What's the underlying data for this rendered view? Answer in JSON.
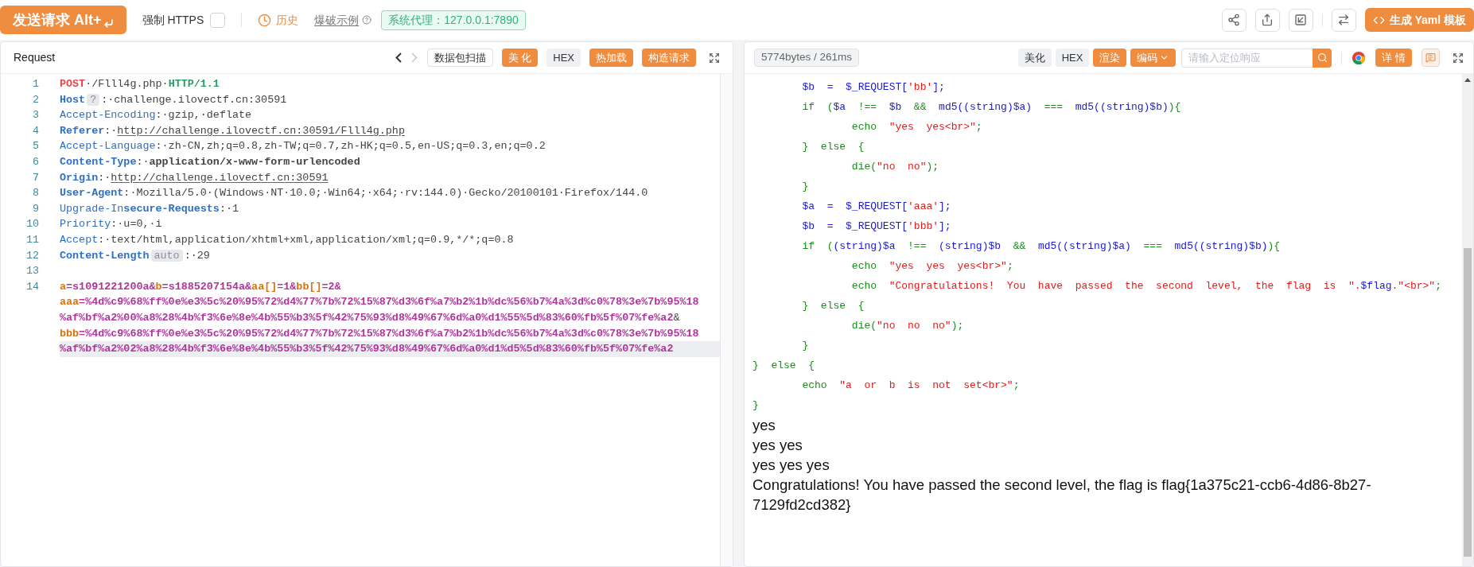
{
  "top_bar": {
    "send_button": "发送请求 Alt+",
    "force_https": {
      "label": "强制 HTTPS",
      "checked": false
    },
    "history": "历史",
    "examples": "爆破示例",
    "proxy": "系统代理：127.0.0.1:7890",
    "yaml_button": "生成 Yaml 模板"
  },
  "request": {
    "title": "Request",
    "back_disabled": false,
    "forward_disabled": true,
    "buttons": [
      {
        "label": "数据包扫描",
        "kind": "outline"
      },
      {
        "label": "美 化",
        "kind": "primary"
      },
      {
        "label": "HEX",
        "kind": "plain"
      },
      {
        "label": "热加载",
        "kind": "primary"
      },
      {
        "label": "构造请求",
        "kind": "primary"
      }
    ],
    "lines": [
      {
        "number": "1",
        "rows": [
          {
            "cursor": false,
            "segments": [
              {
                "kind": "method",
                "text": "POST"
              },
              {
                "kind": "text",
                "text": "·/Flll4g.php·"
              },
              {
                "kind": "protocol",
                "text": "HTTP/1.1"
              }
            ]
          }
        ]
      },
      {
        "number": "2",
        "rows": [
          {
            "cursor": false,
            "segments": [
              {
                "kind": "key_bold",
                "text": "Host"
              },
              {
                "kind": "badge",
                "text": "?"
              },
              {
                "kind": "text",
                "text": ":·challenge.ilovectf.cn:30591"
              }
            ]
          }
        ]
      },
      {
        "number": "3",
        "rows": [
          {
            "cursor": false,
            "segments": [
              {
                "kind": "key",
                "text": "Accept-Encoding"
              },
              {
                "kind": "text",
                "text": ":·gzip,·deflate"
              }
            ]
          }
        ]
      },
      {
        "number": "4",
        "rows": [
          {
            "cursor": false,
            "segments": [
              {
                "kind": "key_bold",
                "text": "Referer"
              },
              {
                "kind": "text",
                "text": ":·"
              },
              {
                "kind": "url",
                "text": "http://challenge.ilovectf.cn:30591/Flll4g.php"
              }
            ]
          }
        ]
      },
      {
        "number": "5",
        "rows": [
          {
            "cursor": false,
            "segments": [
              {
                "kind": "key",
                "text": "Accept-Language"
              },
              {
                "kind": "text",
                "text": ":·zh-CN,zh;q=0.8,zh-TW;q=0.7,zh-HK;q=0.5,en-US;q=0.3,en;q=0.2"
              }
            ]
          }
        ]
      },
      {
        "number": "6",
        "rows": [
          {
            "cursor": false,
            "segments": [
              {
                "kind": "key_bold",
                "text": "Content-Type"
              },
              {
                "kind": "text",
                "text": ":·"
              },
              {
                "kind": "text_bold",
                "text": "application/x-www-form-urlencoded"
              }
            ]
          }
        ]
      },
      {
        "number": "7",
        "rows": [
          {
            "cursor": false,
            "segments": [
              {
                "kind": "key_bold",
                "text": "Origin"
              },
              {
                "kind": "text",
                "text": ":·"
              },
              {
                "kind": "url",
                "text": "http://challenge.ilovectf.cn:30591"
              }
            ]
          }
        ]
      },
      {
        "number": "8",
        "rows": [
          {
            "cursor": false,
            "segments": [
              {
                "kind": "key_bold",
                "text": "User-Agent"
              },
              {
                "kind": "text",
                "text": ":·Mozilla/5.0·(Windows·NT·10.0;·Win64;·x64;·rv:144.0)·Gecko/20100101·Firefox/144.0"
              }
            ]
          }
        ]
      },
      {
        "number": "9",
        "rows": [
          {
            "cursor": false,
            "segments": [
              {
                "kind": "key",
                "text": "Upgrade-In"
              },
              {
                "kind": "key_bold",
                "text": "secure-Requests"
              },
              {
                "kind": "text",
                "text": ":·1"
              }
            ]
          }
        ]
      },
      {
        "number": "10",
        "rows": [
          {
            "cursor": false,
            "segments": [
              {
                "kind": "key",
                "text": "Priority"
              },
              {
                "kind": "text",
                "text": ":·u=0,·i"
              }
            ]
          }
        ]
      },
      {
        "number": "11",
        "rows": [
          {
            "cursor": false,
            "segments": [
              {
                "kind": "key",
                "text": "Accept"
              },
              {
                "kind": "text",
                "text": ":·text/html,application/xhtml+xml,application/xml;q=0.9,*/*;q=0.8"
              }
            ]
          }
        ]
      },
      {
        "number": "12",
        "rows": [
          {
            "cursor": false,
            "segments": [
              {
                "kind": "key_bold",
                "text": "Content-Length"
              },
              {
                "kind": "badge",
                "text": "auto"
              },
              {
                "kind": "text",
                "text": ":·29"
              }
            ]
          }
        ]
      },
      {
        "number": "13",
        "rows": [
          {
            "cursor": false,
            "segments": []
          }
        ]
      },
      {
        "number": "14",
        "rows": [
          {
            "cursor": false,
            "segments": [
              {
                "kind": "param_key",
                "text": "a"
              },
              {
                "kind": "param_value",
                "text": "=s1091221200a&"
              },
              {
                "kind": "param_key",
                "text": "b"
              },
              {
                "kind": "param_value",
                "text": "=s1885207154a&"
              },
              {
                "kind": "param_key",
                "text": "aa[]"
              },
              {
                "kind": "param_value",
                "text": "=1&"
              },
              {
                "kind": "param_key",
                "text": "bb[]"
              },
              {
                "kind": "param_value",
                "text": "=2&"
              }
            ]
          },
          {
            "cursor": false,
            "segments": [
              {
                "kind": "param_key",
                "text": "aaa"
              },
              {
                "kind": "param_value",
                "text": "=%4d%c9%68%ff%0e%e3%5c%20%95%72%d4%77%7b%72%15%87%d3%6f%a7%b2%1b%dc%56%b7%4a%3d%c0%78%3e%7b%95%18"
              }
            ]
          },
          {
            "cursor": false,
            "segments": [
              {
                "kind": "param_value",
                "text": "%af%bf%a2%00%a8%28%4b%f3%6e%8e%4b%55%b3%5f%42%75%93%d8%49%67%6d%a0%d1%55%5d%83%60%fb%5f%07%fe%a2"
              },
              {
                "kind": "text",
                "text": "&"
              }
            ]
          },
          {
            "cursor": false,
            "segments": [
              {
                "kind": "param_key",
                "text": "bbb"
              },
              {
                "kind": "param_value",
                "text": "=%4d%c9%68%ff%0e%e3%5c%20%95%72%d4%77%7b%72%15%87%d3%6f%a7%b2%1b%dc%56%b7%4a%3d%c0%78%3e%7b%95%18"
              }
            ]
          },
          {
            "cursor": true,
            "segments": [
              {
                "kind": "param_value",
                "text": "%af%bf%a2%02%a8%28%4b%f3%6e%8e%4b%55%b3%5f%42%75%93%d8%49%67%6d%a0%d1%d5%5d%83%60%fb%5f%07%fe%a2"
              }
            ]
          }
        ]
      }
    ]
  },
  "response": {
    "stats": "5774bytes / 261ms",
    "buttons": [
      {
        "label": "美化",
        "kind": "plain"
      },
      {
        "label": "HEX",
        "kind": "plain"
      },
      {
        "label": "渲染",
        "kind": "primary"
      }
    ],
    "encoding": "编码",
    "search": {
      "placeholder": "请输入定位响应"
    },
    "details": "详 情",
    "code": [
      [
        {
          "kind": "var",
          "text": "        $b  =  $_REQUEST["
        },
        {
          "kind": "str",
          "text": "'bb'"
        },
        {
          "kind": "var",
          "text": "];"
        }
      ],
      [
        {
          "kind": "kw",
          "text": "        if  ("
        },
        {
          "kind": "var",
          "text": "$a"
        },
        {
          "kind": "kw",
          "text": "  !==  "
        },
        {
          "kind": "var",
          "text": "$b"
        },
        {
          "kind": "kw",
          "text": "  &&  "
        },
        {
          "kind": "var",
          "text": "md5((string)$a)"
        },
        {
          "kind": "kw",
          "text": "  ===  "
        },
        {
          "kind": "var",
          "text": "md5((string)$b)"
        },
        {
          "kind": "kw",
          "text": "){"
        }
      ],
      [
        {
          "kind": "kw",
          "text": "                echo  "
        },
        {
          "kind": "str",
          "text": "\"yes  yes<br>\""
        },
        {
          "kind": "kw",
          "text": ";"
        }
      ],
      [
        {
          "kind": "kw",
          "text": "        }  else  {"
        }
      ],
      [
        {
          "kind": "kw",
          "text": "                die("
        },
        {
          "kind": "str",
          "text": "\"no  no\""
        },
        {
          "kind": "kw",
          "text": ");"
        }
      ],
      [
        {
          "kind": "kw",
          "text": "        }"
        }
      ],
      [
        {
          "kind": "var",
          "text": "        $a  =  $_REQUEST["
        },
        {
          "kind": "str",
          "text": "'aaa'"
        },
        {
          "kind": "var",
          "text": "];"
        }
      ],
      [
        {
          "kind": "var",
          "text": "        $b  =  $_REQUEST["
        },
        {
          "kind": "str",
          "text": "'bbb'"
        },
        {
          "kind": "var",
          "text": "];"
        }
      ],
      [
        {
          "kind": "kw",
          "text": "        if  ("
        },
        {
          "kind": "var",
          "text": "(string)$a"
        },
        {
          "kind": "kw",
          "text": "  !==  "
        },
        {
          "kind": "var",
          "text": "(string)$b"
        },
        {
          "kind": "kw",
          "text": "  &&  "
        },
        {
          "kind": "var",
          "text": "md5((string)$a)"
        },
        {
          "kind": "kw",
          "text": "  ===  "
        },
        {
          "kind": "var",
          "text": "md5((string)$b)"
        },
        {
          "kind": "kw",
          "text": "){"
        }
      ],
      [
        {
          "kind": "kw",
          "text": "                echo  "
        },
        {
          "kind": "str",
          "text": "\"yes  yes  yes<br>\""
        },
        {
          "kind": "kw",
          "text": ";"
        }
      ],
      [
        {
          "kind": "kw",
          "text": "                echo  "
        },
        {
          "kind": "str",
          "text": "\"Congratulations!  You  have  passed  the  second  level,  the  flag  is  \"."
        },
        {
          "kind": "var",
          "text": "$flag"
        },
        {
          "kind": "str",
          "text": ".\"<br>\""
        },
        {
          "kind": "kw",
          "text": ";"
        }
      ],
      [
        {
          "kind": "kw",
          "text": "        }  else  {"
        }
      ],
      [
        {
          "kind": "kw",
          "text": "                die("
        },
        {
          "kind": "str",
          "text": "\"no  no  no\""
        },
        {
          "kind": "kw",
          "text": ");"
        }
      ],
      [
        {
          "kind": "kw",
          "text": "        }"
        }
      ],
      [
        {
          "kind": "kw",
          "text": "}  else  {"
        }
      ],
      [
        {
          "kind": "kw",
          "text": "        echo  "
        },
        {
          "kind": "str",
          "text": "\"a  or  b  is  not  set<br>\""
        },
        {
          "kind": "kw",
          "text": ";"
        }
      ],
      [
        {
          "kind": "kw",
          "text": "}"
        }
      ]
    ],
    "output": [
      "yes",
      "yes yes",
      "yes yes yes",
      "Congratulations! You have passed the second level, the flag is flag{1a375c21-ccb6-4d86-8b27-7129fd2cd382}"
    ]
  }
}
